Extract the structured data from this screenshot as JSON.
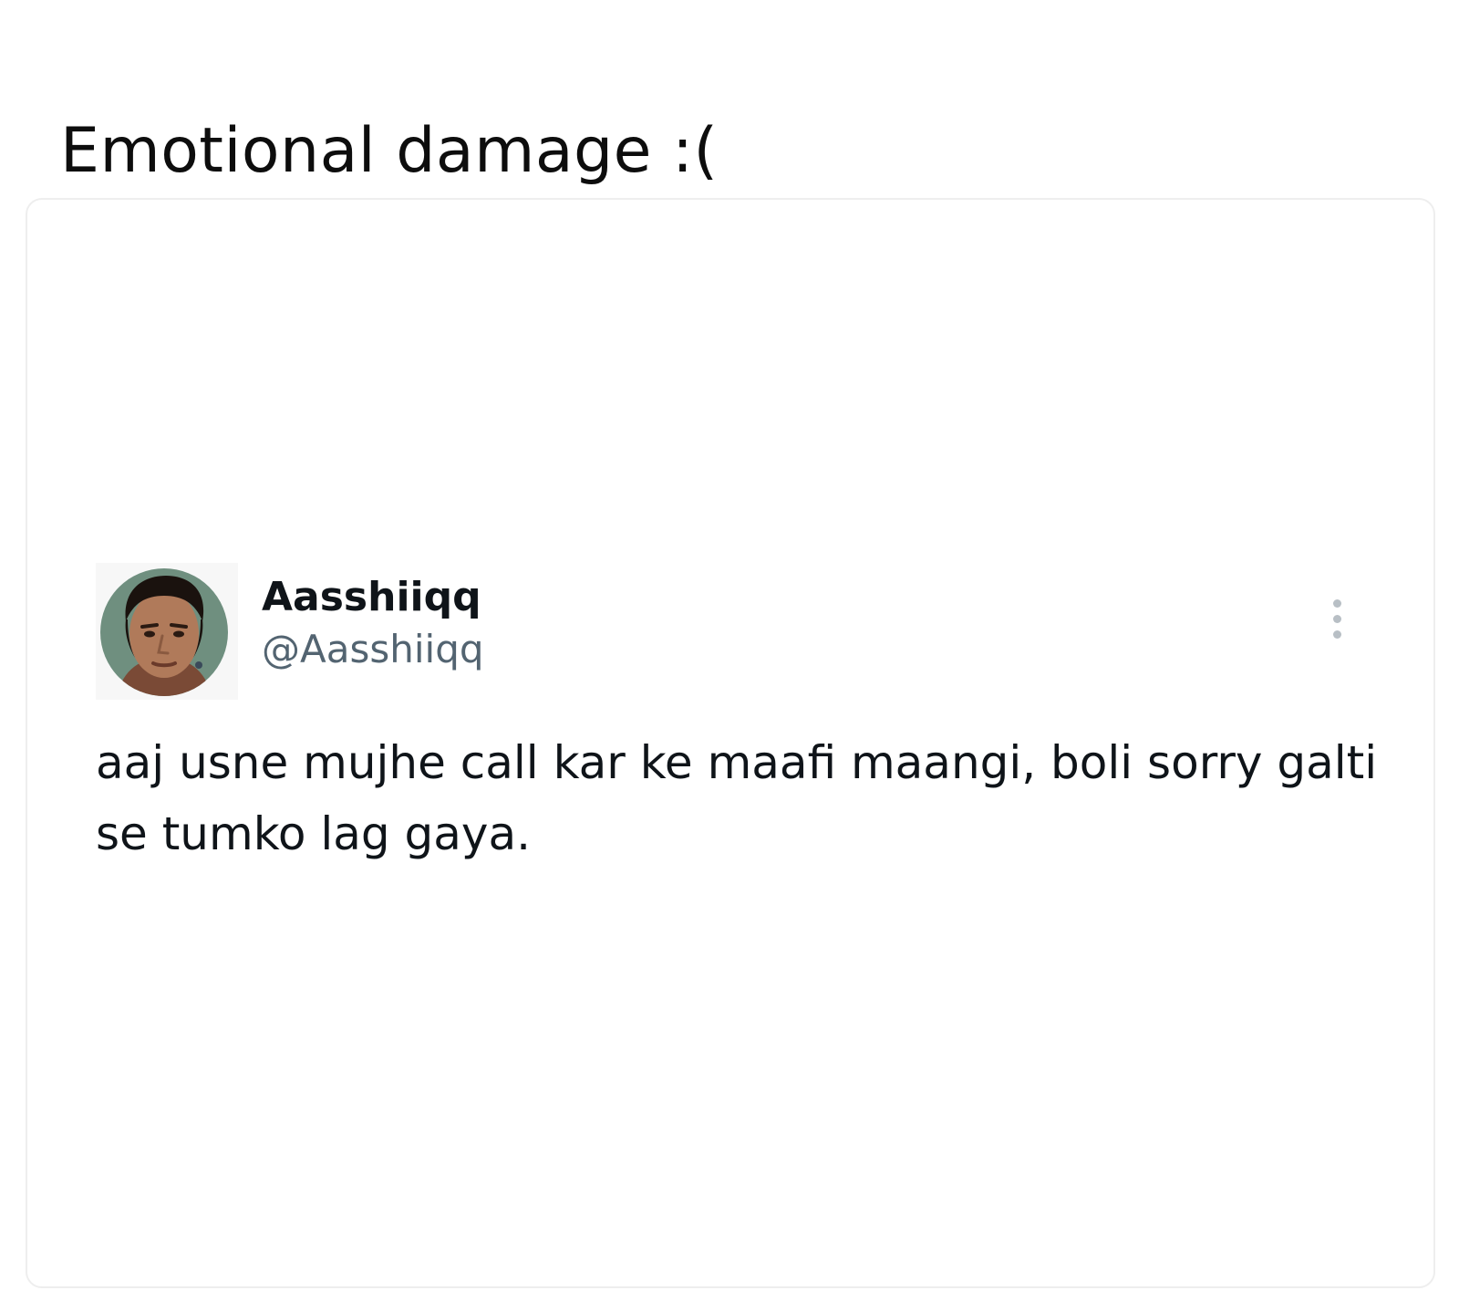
{
  "post": {
    "title": "Emotional damage :("
  },
  "tweet": {
    "display_name": "Aasshiiqq",
    "handle": "@Aasshiiqq",
    "text": "aaj usne mujhe call kar ke maafi maangi, boli sorry galti se tumko lag gaya.",
    "avatar_icon": "profile-photo",
    "more_icon": "more-vertical-icon"
  },
  "colors": {
    "background": "#ffffff",
    "card_border": "#eeeeee",
    "name_text": "#0f1419",
    "handle_text": "#536471",
    "more_dots": "#b8bfc5"
  }
}
